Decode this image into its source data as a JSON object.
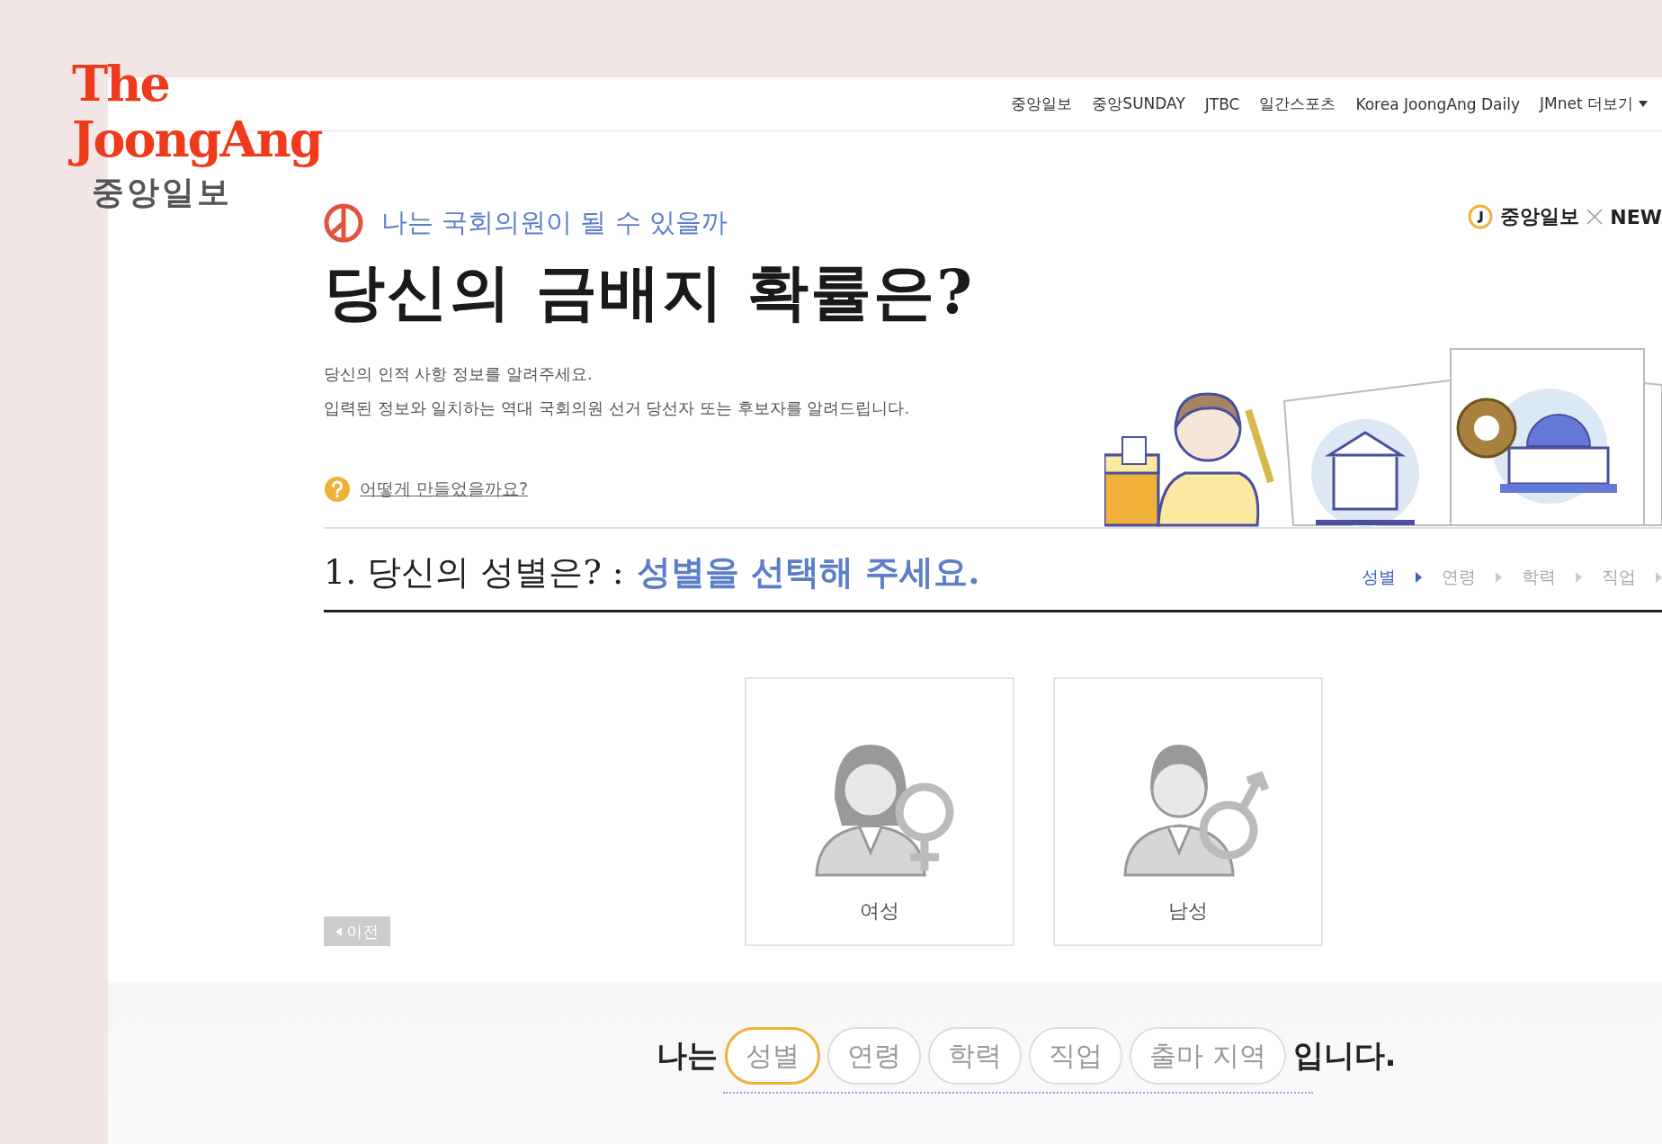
{
  "brand": {
    "line1": "The",
    "line2": "JoongAng",
    "subtitle": "중앙일보"
  },
  "nav": {
    "items": [
      "중앙일보",
      "중앙SUNDAY",
      "JTBC",
      "일간스포츠",
      "Korea JoongAng Daily",
      "JMnet 더보기"
    ]
  },
  "partner": {
    "name": "중앙일보",
    "other": "NEW"
  },
  "hero": {
    "kicker": "나는 국회의원이 될 수 있을까",
    "title": "당신의 금배지 확률은?",
    "description": [
      "당신의 인적 사항 정보를 알려주세요.",
      "입력된 정보와 일치하는 역대 국회의원 선거 당선자 또는 후보자를 알려드립니다."
    ],
    "help_link": "어떻게 만들었을까요?"
  },
  "question": {
    "number_label": "1. 당신의 성별은? :",
    "prompt": "성별을 선택해 주세요.",
    "steps": [
      {
        "label": "성별",
        "selected": true
      },
      {
        "label": "연령",
        "selected": false
      },
      {
        "label": "학력",
        "selected": false
      },
      {
        "label": "직업",
        "selected": false
      }
    ]
  },
  "options": [
    {
      "label": "여성",
      "kind": "female"
    },
    {
      "label": "남성",
      "kind": "male"
    }
  ],
  "back_button": {
    "label": "이전"
  },
  "summary": {
    "prefix": "나는",
    "chips": [
      {
        "label": "성별",
        "selected": true
      },
      {
        "label": "연령",
        "selected": false
      },
      {
        "label": "학력",
        "selected": false
      },
      {
        "label": "직업",
        "selected": false
      },
      {
        "label": "출마 지역",
        "selected": false
      }
    ],
    "suffix": "입니다."
  }
}
